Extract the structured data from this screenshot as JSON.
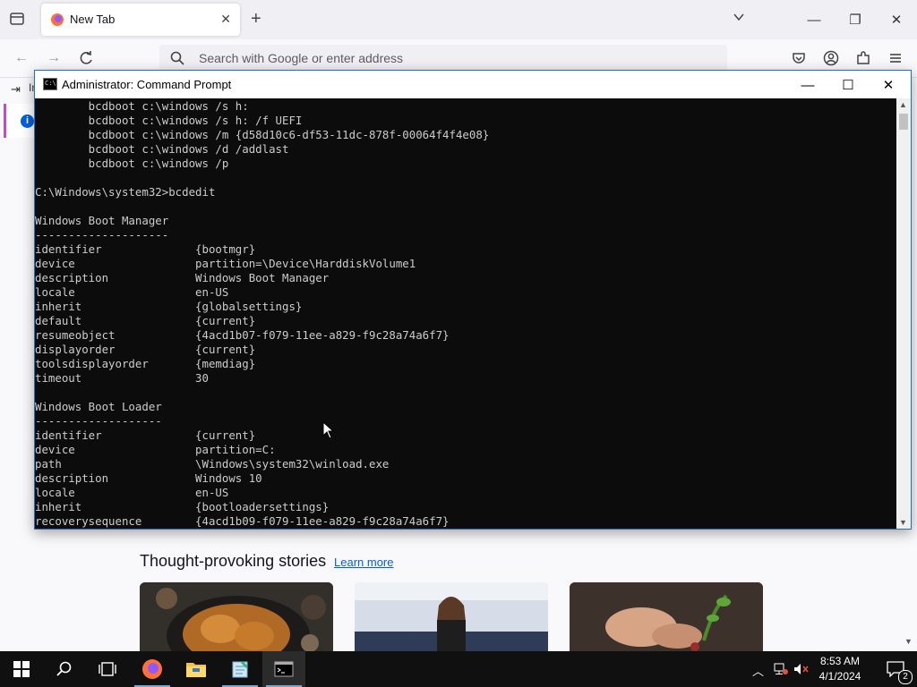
{
  "browser": {
    "tab_title": "New Tab",
    "tab_close": "✕",
    "new_tab": "+",
    "url_placeholder": "Search with Google or enter address",
    "bookmark_label": "Im"
  },
  "window_controls": {
    "minimize": "—",
    "restore": "❐",
    "close": "✕"
  },
  "newtab": {
    "stories_heading": "Thought-provoking stories",
    "learn_more": "Learn more"
  },
  "cmd": {
    "title": "Administrator: Command Prompt",
    "minimize": "—",
    "maximize": "☐",
    "close": "✕",
    "lines": [
      "        bcdboot c:\\windows /s h:",
      "        bcdboot c:\\windows /s h: /f UEFI",
      "        bcdboot c:\\windows /m {d58d10c6-df53-11dc-878f-00064f4f4e08}",
      "        bcdboot c:\\windows /d /addlast",
      "        bcdboot c:\\windows /p",
      "",
      "C:\\Windows\\system32>bcdedit",
      "",
      "Windows Boot Manager",
      "--------------------",
      "identifier              {bootmgr}",
      "device                  partition=\\Device\\HarddiskVolume1",
      "description             Windows Boot Manager",
      "locale                  en-US",
      "inherit                 {globalsettings}",
      "default                 {current}",
      "resumeobject            {4acd1b07-f079-11ee-a829-f9c28a74a6f7}",
      "displayorder            {current}",
      "toolsdisplayorder       {memdiag}",
      "timeout                 30",
      "",
      "Windows Boot Loader",
      "-------------------",
      "identifier              {current}",
      "device                  partition=C:",
      "path                    \\Windows\\system32\\winload.exe",
      "description             Windows 10",
      "locale                  en-US",
      "inherit                 {bootloadersettings}",
      "recoverysequence        {4acd1b09-f079-11ee-a829-f9c28a74a6f7}"
    ]
  },
  "taskbar": {
    "time": "8:53 AM",
    "date": "4/1/2024",
    "notification_count": "2"
  }
}
